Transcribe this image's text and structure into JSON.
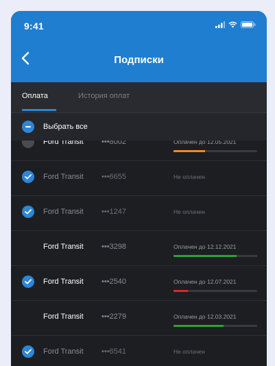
{
  "status_bar": {
    "time": "9:41"
  },
  "nav": {
    "title": "Подписки"
  },
  "tabs": [
    {
      "label": "Оплата",
      "active": true
    },
    {
      "label": "История оплат",
      "active": false
    }
  ],
  "select_all": {
    "label": "Выбрать все"
  },
  "colors": {
    "header_blue": "#1f7ecf",
    "accent_blue": "#2e86d6",
    "progress_orange": "#f08a24",
    "progress_green": "#2aa336",
    "progress_red": "#d62a2a"
  },
  "subscriptions": [
    {
      "model": "Ford Transit",
      "plate": "•••8002",
      "status": "Оплачен до 12.05.2021",
      "selected": false,
      "progress": 0.38,
      "progress_color": "#f08a24"
    },
    {
      "model": "Ford Transit",
      "plate": "•••6655",
      "status": "Не оплачен",
      "selected": true,
      "progress": null,
      "progress_color": null
    },
    {
      "model": "Ford Transit",
      "plate": "•••1247",
      "status": "Не оплачен",
      "selected": true,
      "progress": null,
      "progress_color": null
    },
    {
      "model": "Ford Transit",
      "plate": "•••3298",
      "status": "Оплачен до 12.12.2021",
      "selected": false,
      "progress": 0.75,
      "progress_color": "#2aa336"
    },
    {
      "model": "Ford Transit",
      "plate": "•••2540",
      "status": "Оплачен до 12.07.2021",
      "selected": true,
      "progress": 0.17,
      "progress_color": "#d62a2a"
    },
    {
      "model": "Ford Transit",
      "plate": "•••2279",
      "status": "Оплачен до 12.03.2021",
      "selected": false,
      "progress": 0.6,
      "progress_color": "#2aa336"
    },
    {
      "model": "Ford Transit",
      "plate": "•••6541",
      "status": "Не оплачен",
      "selected": true,
      "progress": null,
      "progress_color": null
    }
  ]
}
